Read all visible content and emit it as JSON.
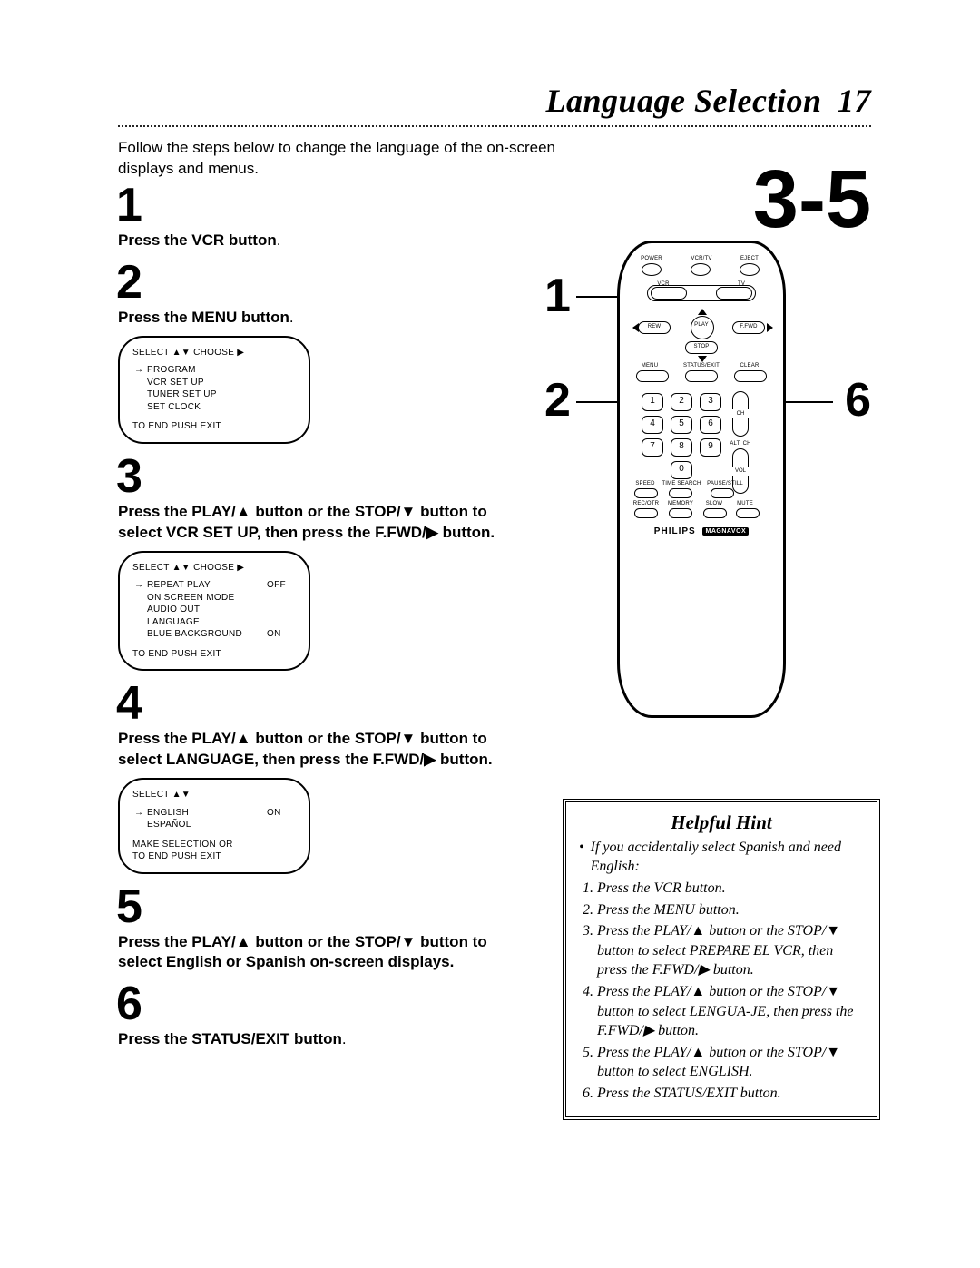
{
  "title": "Language Selection",
  "page_number": "17",
  "intro": "Follow the steps below to change the language of the on-screen displays and menus.",
  "big_range": "3-5",
  "callouts": {
    "c1": "1",
    "c2": "2",
    "c6": "6"
  },
  "steps": [
    {
      "n": "1",
      "text_bold": "Press the VCR button",
      "text_rest": "."
    },
    {
      "n": "2",
      "text_bold": "Press the MENU button",
      "text_rest": "."
    },
    {
      "n": "3",
      "text_bold": "Press the PLAY/▲ button or the STOP/▼ button to select VCR SET UP, then press the F.FWD/▶ button.",
      "text_rest": ""
    },
    {
      "n": "4",
      "text_bold": "Press the PLAY/▲ button or the STOP/▼ button to select LANGUAGE, then press the F.FWD/▶ button.",
      "text_rest": ""
    },
    {
      "n": "5",
      "text_bold": "Press the PLAY/▲ button or the STOP/▼ button to select English or Spanish on-screen displays.",
      "text_rest": ""
    },
    {
      "n": "6",
      "text_bold": "Press the STATUS/EXIT button",
      "text_rest": "."
    }
  ],
  "osd1": {
    "header": "SELECT ▲▼ CHOOSE ▶",
    "rows": [
      {
        "arrow": "→",
        "label": "PROGRAM",
        "value": ""
      },
      {
        "arrow": "",
        "label": "VCR SET UP",
        "value": ""
      },
      {
        "arrow": "",
        "label": "TUNER SET UP",
        "value": ""
      },
      {
        "arrow": "",
        "label": "SET CLOCK",
        "value": ""
      }
    ],
    "footer": "TO END PUSH EXIT"
  },
  "osd2": {
    "header": "SELECT ▲▼ CHOOSE ▶",
    "rows": [
      {
        "arrow": "→",
        "label": "REPEAT PLAY",
        "value": "OFF"
      },
      {
        "arrow": "",
        "label": "ON SCREEN MODE",
        "value": ""
      },
      {
        "arrow": "",
        "label": "AUDIO OUT",
        "value": ""
      },
      {
        "arrow": "",
        "label": "LANGUAGE",
        "value": ""
      },
      {
        "arrow": "",
        "label": "BLUE BACKGROUND",
        "value": "ON"
      }
    ],
    "footer": "TO END PUSH EXIT"
  },
  "osd3": {
    "header": "SELECT ▲▼",
    "rows": [
      {
        "arrow": "→",
        "label": "ENGLISH",
        "value": "ON"
      },
      {
        "arrow": "",
        "label": "ESPAÑOL",
        "value": ""
      }
    ],
    "footer1": "MAKE SELECTION OR",
    "footer2": "TO END PUSH EXIT"
  },
  "remote": {
    "labels": {
      "power": "POWER",
      "vcrtv": "VCR/TV",
      "eject": "EJECT",
      "vcr": "VCR",
      "tv": "TV",
      "play": "PLAY",
      "rew": "REW",
      "ffwd": "F.FWD",
      "stop": "STOP",
      "menu": "MENU",
      "status": "STATUS/EXIT",
      "clear": "CLEAR",
      "speed": "SPEED",
      "time": "TIME SEARCH",
      "pause": "PAUSE/STILL",
      "recotr": "REC/OTR",
      "memory": "MEMORY",
      "slow": "SLOW",
      "mute": "MUTE",
      "ch": "CH",
      "altch": "ALT. CH",
      "vol": "VOL"
    },
    "nums": [
      "1",
      "2",
      "3",
      "4",
      "5",
      "6",
      "7",
      "8",
      "9",
      "0"
    ],
    "brand": "PHILIPS",
    "brand_box": "MAGNAVOX"
  },
  "hint": {
    "title": "Helpful Hint",
    "lead": "If you accidentally select Spanish and need English:",
    "items": [
      "Press the VCR button.",
      "Press the MENU button.",
      "Press the PLAY/▲ button or the STOP/▼ button to select PREPARE EL VCR, then press the F.FWD/▶ button.",
      "Press the PLAY/▲ button or the STOP/▼ button to select LENGUA-JE, then press the F.FWD/▶ button.",
      "Press the PLAY/▲ button or the STOP/▼ button to select ENGLISH.",
      "Press the STATUS/EXIT button."
    ]
  }
}
